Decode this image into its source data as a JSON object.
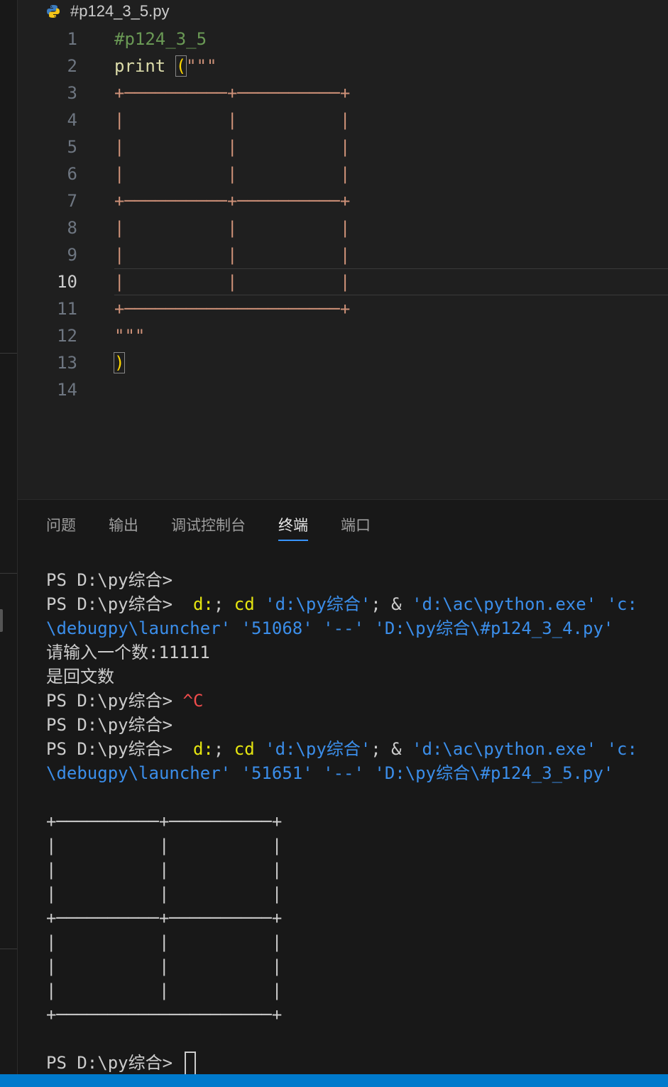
{
  "editor": {
    "breadcrumb": "#p124_3_5.py",
    "lines": [
      {
        "n": "1",
        "parts": [
          {
            "t": "#p124_3_5",
            "c": "c-comment"
          }
        ]
      },
      {
        "n": "2",
        "parts": [
          {
            "t": "print ",
            "c": "c-fn"
          },
          {
            "t": "(",
            "c": "c-paren"
          },
          {
            "t": "\"\"\"",
            "c": "c-str"
          }
        ]
      },
      {
        "n": "3",
        "parts": [
          {
            "t": "+──────────+──────────+",
            "c": "c-str"
          }
        ]
      },
      {
        "n": "4",
        "parts": [
          {
            "t": "|          |          |",
            "c": "c-str"
          }
        ]
      },
      {
        "n": "5",
        "parts": [
          {
            "t": "|          |          |",
            "c": "c-str"
          }
        ]
      },
      {
        "n": "6",
        "parts": [
          {
            "t": "|          |          |",
            "c": "c-str"
          }
        ]
      },
      {
        "n": "7",
        "parts": [
          {
            "t": "+──────────+──────────+",
            "c": "c-str"
          }
        ]
      },
      {
        "n": "8",
        "parts": [
          {
            "t": "|          |          |",
            "c": "c-str"
          }
        ]
      },
      {
        "n": "9",
        "parts": [
          {
            "t": "|          |          |",
            "c": "c-str"
          }
        ]
      },
      {
        "n": "10",
        "parts": [
          {
            "t": "|          |          |",
            "c": "c-str"
          }
        ]
      },
      {
        "n": "11",
        "parts": [
          {
            "t": "+─────────────────────+",
            "c": "c-str"
          }
        ]
      },
      {
        "n": "12",
        "parts": [
          {
            "t": "\"\"\"",
            "c": "c-str"
          }
        ]
      },
      {
        "n": "13",
        "parts": [
          {
            "t": ")",
            "c": "c-paren"
          }
        ]
      },
      {
        "n": "14",
        "parts": []
      }
    ],
    "active_line": "10"
  },
  "panel": {
    "tabs": [
      {
        "label": "问题",
        "active": false
      },
      {
        "label": "输出",
        "active": false
      },
      {
        "label": "调试控制台",
        "active": false
      },
      {
        "label": "终端",
        "active": true
      },
      {
        "label": "端口",
        "active": false
      }
    ],
    "terminal_lines": [
      [
        {
          "t": "PS D:\\py综合> ",
          "c": ""
        }
      ],
      [
        {
          "t": "PS D:\\py综合>  ",
          "c": ""
        },
        {
          "t": "d:",
          "c": "t-yel"
        },
        {
          "t": "; ",
          "c": ""
        },
        {
          "t": "cd",
          "c": "t-yel"
        },
        {
          "t": " 'd:\\py综合'",
          "c": "t-cyan"
        },
        {
          "t": "; & ",
          "c": ""
        },
        {
          "t": "'d:\\ac\\python.exe'",
          "c": "t-cyan"
        },
        {
          "t": " 'c:",
          "c": "t-cyan"
        }
      ],
      [
        {
          "t": "\\debugpy\\launcher' '51068' '--' 'D:\\py综合\\#p124_3_4.py'",
          "c": "t-cyan"
        }
      ],
      [
        {
          "t": "请输入一个数:11111",
          "c": ""
        }
      ],
      [
        {
          "t": "是回文数",
          "c": ""
        }
      ],
      [
        {
          "t": "PS D:\\py综合> ",
          "c": ""
        },
        {
          "t": "^C",
          "c": "t-red"
        }
      ],
      [
        {
          "t": "PS D:\\py综合> ",
          "c": ""
        }
      ],
      [
        {
          "t": "PS D:\\py综合>  ",
          "c": ""
        },
        {
          "t": "d:",
          "c": "t-yel"
        },
        {
          "t": "; ",
          "c": ""
        },
        {
          "t": "cd",
          "c": "t-yel"
        },
        {
          "t": " 'd:\\py综合'",
          "c": "t-cyan"
        },
        {
          "t": "; & ",
          "c": ""
        },
        {
          "t": "'d:\\ac\\python.exe'",
          "c": "t-cyan"
        },
        {
          "t": " 'c:",
          "c": "t-cyan"
        }
      ],
      [
        {
          "t": "\\debugpy\\launcher' '51651' '--' 'D:\\py综合\\#p124_3_5.py'",
          "c": "t-cyan"
        }
      ],
      [
        {
          "t": "",
          "c": ""
        }
      ],
      [
        {
          "t": "+──────────+──────────+",
          "c": ""
        }
      ],
      [
        {
          "t": "|          |          |",
          "c": ""
        }
      ],
      [
        {
          "t": "|          |          |",
          "c": ""
        }
      ],
      [
        {
          "t": "|          |          |",
          "c": ""
        }
      ],
      [
        {
          "t": "+──────────+──────────+",
          "c": ""
        }
      ],
      [
        {
          "t": "|          |          |",
          "c": ""
        }
      ],
      [
        {
          "t": "|          |          |",
          "c": ""
        }
      ],
      [
        {
          "t": "|          |          |",
          "c": ""
        }
      ],
      [
        {
          "t": "+─────────────────────+",
          "c": ""
        }
      ],
      [
        {
          "t": "",
          "c": ""
        }
      ]
    ],
    "prompt": "PS D:\\py综合> "
  }
}
